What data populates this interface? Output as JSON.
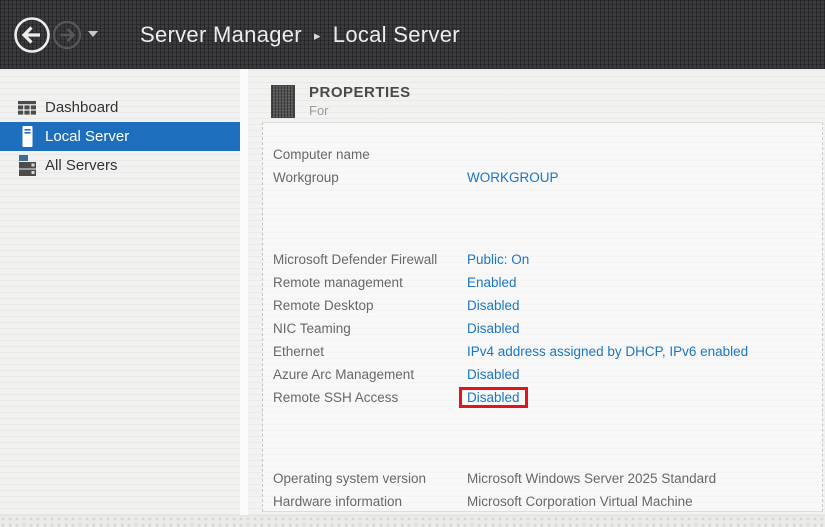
{
  "topbar": {
    "breadcrumb": {
      "root": "Server Manager",
      "separator": "▸",
      "current": "Local Server"
    }
  },
  "sidebar": {
    "selected": "Local Server",
    "selected_color": "#1d6ebd",
    "items": [
      {
        "label": "Dashboard",
        "icon": "dashboard-grid-icon",
        "selected": false
      },
      {
        "label": "Local Server",
        "icon": "server-tower-icon",
        "selected": true
      },
      {
        "label": "All Servers",
        "icon": "server-stack-icon",
        "selected": false
      }
    ]
  },
  "main": {
    "section": {
      "title": "PROPERTIES",
      "subtitle": "For"
    },
    "link_color": "#1b76c4",
    "highlight_color": "#e0161c",
    "properties": [
      {
        "label": "Computer name",
        "value": "",
        "style": "link",
        "highlighted": false
      },
      {
        "label": "Workgroup",
        "value": "WORKGROUP",
        "style": "link",
        "highlighted": false
      },
      {
        "label": "Microsoft Defender Firewall",
        "value": "Public: On",
        "style": "link",
        "highlighted": false
      },
      {
        "label": "Remote management",
        "value": "Enabled",
        "style": "link",
        "highlighted": false
      },
      {
        "label": "Remote Desktop",
        "value": "Disabled",
        "style": "link",
        "highlighted": false
      },
      {
        "label": "NIC Teaming",
        "value": "Disabled",
        "style": "link",
        "highlighted": false
      },
      {
        "label": "Ethernet",
        "value": "IPv4 address assigned by DHCP, IPv6 enabled",
        "style": "link",
        "highlighted": false
      },
      {
        "label": "Azure Arc Management",
        "value": "Disabled",
        "style": "link",
        "highlighted": false
      },
      {
        "label": "Remote SSH Access",
        "value": "Disabled",
        "style": "link",
        "highlighted": true
      },
      {
        "label": "Operating system version",
        "value": "Microsoft Windows Server 2025 Standard",
        "style": "static",
        "highlighted": false
      },
      {
        "label": "Hardware information",
        "value": "Microsoft Corporation Virtual Machine",
        "style": "static",
        "highlighted": false
      }
    ]
  }
}
